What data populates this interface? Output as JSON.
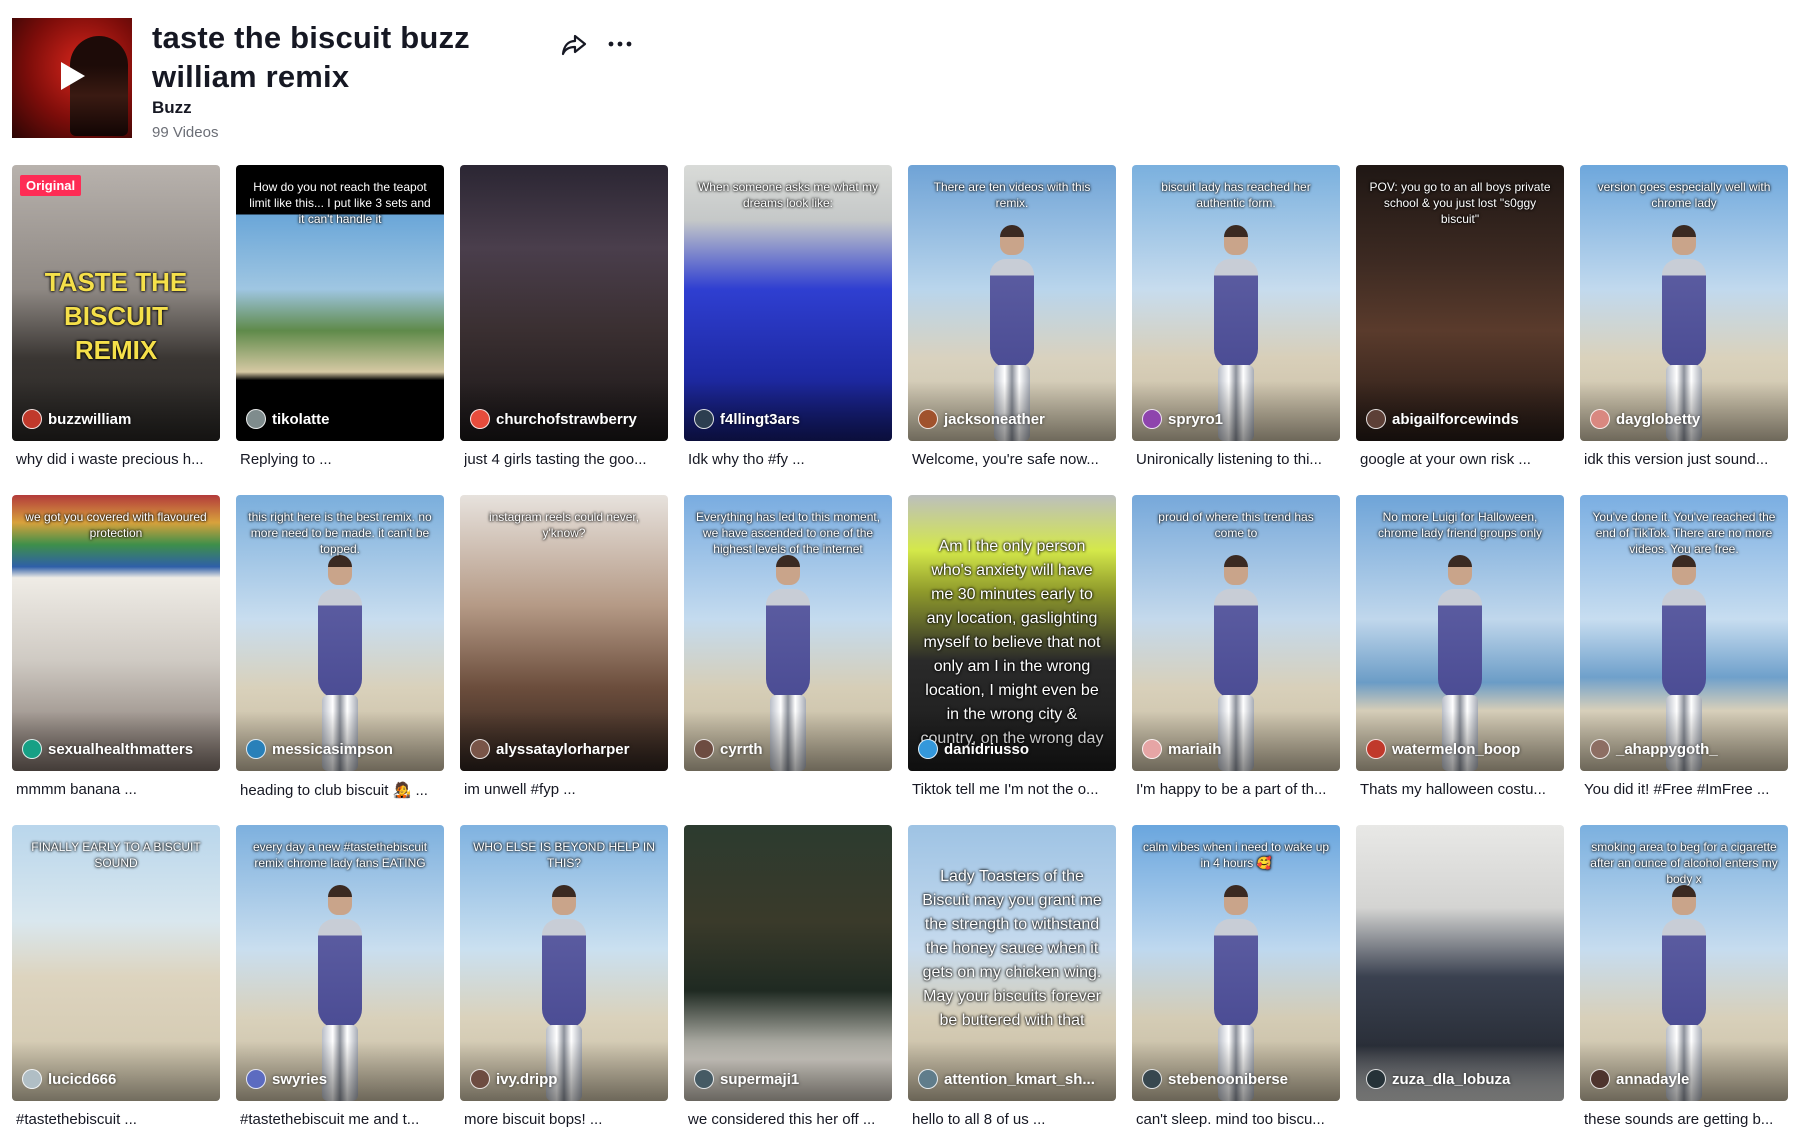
{
  "header": {
    "title": "taste the biscuit buzz william remix",
    "author": "Buzz",
    "video_count": "99 Videos",
    "share_icon": "share-arrow-icon",
    "more_icon": "more-dots-icon"
  },
  "videos": [
    {
      "username": "buzzwilliam",
      "caption": "why did i waste precious h...",
      "badge": "Original",
      "overlay": "TASTE THE BISCUIT REMIX"
    },
    {
      "username": "tikolatte",
      "caption": "Replying to ...",
      "overlay": "How do you not reach the teapot limit like this... I put like 3 sets and it can't handle it"
    },
    {
      "username": "churchofstrawberry",
      "caption": "just 4 girls tasting the goo...",
      "overlay": ""
    },
    {
      "username": "f4llingt3ars",
      "caption": "Idk why tho #fy ...",
      "overlay": "When someone asks me what my dreams look like:"
    },
    {
      "username": "jacksoneather",
      "caption": "Welcome, you're safe now...",
      "overlay": "There are ten videos with this remix."
    },
    {
      "username": "spryro1",
      "caption": "Unironically listening to thi...",
      "overlay": "biscuit lady has reached her authentic form."
    },
    {
      "username": "abigailforcewinds",
      "caption": "google at your own risk ...",
      "overlay": "POV: you go to an all boys private school & you just lost \"s0ggy biscuit\""
    },
    {
      "username": "dayglobetty",
      "caption": "idk this version just sound...",
      "overlay": "version goes especially well with chrome lady"
    },
    {
      "username": "sexualhealthmatters",
      "caption": "mmmm banana ...",
      "overlay": "we got you covered with flavoured protection"
    },
    {
      "username": "messicasimpson",
      "caption": "heading to club biscuit 🧑‍🎤 ...",
      "overlay": "this right here is the best remix. no more need to be made. it can't be topped."
    },
    {
      "username": "alyssataylorharper",
      "caption": "im unwell #fyp ...",
      "overlay": "instagram reels could never, y'know?"
    },
    {
      "username": "cyrrth",
      "caption": "",
      "overlay": "Everything has led to this moment, we have ascended to one of the highest levels of the internet"
    },
    {
      "username": "danidriusso",
      "caption": "Tiktok tell me I'm not the o...",
      "overlay": "Am I the only person who's anxiety will have me 30 minutes early to any location, gaslighting myself to believe that not only am I in the wrong location, I might even be in the wrong city & country, on the wrong day"
    },
    {
      "username": "mariaih",
      "caption": "I'm happy to be a part of th...",
      "overlay": "proud of where this trend has come to"
    },
    {
      "username": "watermelon_boop",
      "caption": "Thats my halloween costu...",
      "overlay": "No more Luigi for Halloween, chrome lady friend groups only"
    },
    {
      "username": "_ahappygoth_",
      "caption": "You did it! #Free #ImFree ...",
      "overlay": "You've done it. You've reached the end of TikTok. There are no more videos. You are free."
    },
    {
      "username": "lucicd666",
      "caption": "#tastethebiscuit ...",
      "overlay": "FINALLY EARLY TO A BISCUIT SOUND"
    },
    {
      "username": "swyries",
      "caption": "#tastethebiscuit me and t...",
      "overlay": "every day a new #tastethebiscuit remix chrome lady fans EATING"
    },
    {
      "username": "ivy.dripp",
      "caption": "more biscuit bops! ...",
      "overlay": "WHO ELSE IS BEYOND HELP IN THIS?"
    },
    {
      "username": "supermaji1",
      "caption": "we considered this her off ...",
      "overlay": ""
    },
    {
      "username": "attention_kmart_sh...",
      "caption": "hello to all 8 of us ...",
      "overlay": "Lady Toasters of the Biscuit may you grant me the strength to withstand the honey sauce when it gets on my chicken wing. May your biscuits forever be buttered with that"
    },
    {
      "username": "stebenooniberse",
      "caption": "can't sleep. mind too biscu...",
      "overlay": "calm vibes when i need to wake up in 4 hours 🥰"
    },
    {
      "username": "zuza_dla_lobuza",
      "caption": "",
      "overlay": ""
    },
    {
      "username": "annadayle",
      "caption": "these sounds are getting b...",
      "overlay": "smoking area to beg for a cigarette after an ounce of alcohol enters my body x"
    }
  ],
  "colors": {
    "accent": "#fe2c55",
    "text": "#161823",
    "muted": "#6b6e76"
  }
}
